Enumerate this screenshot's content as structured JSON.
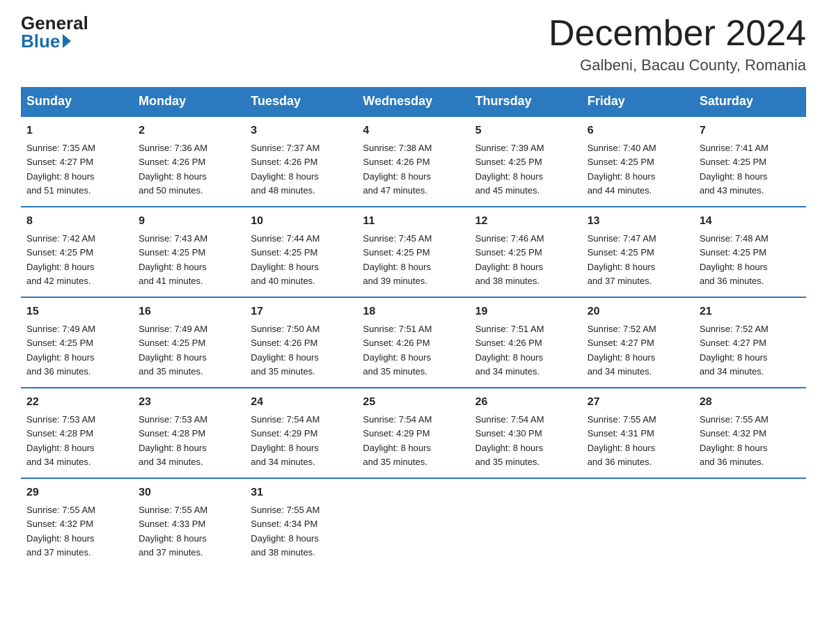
{
  "logo": {
    "general": "General",
    "blue": "Blue"
  },
  "title": "December 2024",
  "subtitle": "Galbeni, Bacau County, Romania",
  "days_of_week": [
    "Sunday",
    "Monday",
    "Tuesday",
    "Wednesday",
    "Thursday",
    "Friday",
    "Saturday"
  ],
  "weeks": [
    [
      {
        "num": "1",
        "sunrise": "7:35 AM",
        "sunset": "4:27 PM",
        "daylight": "8 hours and 51 minutes."
      },
      {
        "num": "2",
        "sunrise": "7:36 AM",
        "sunset": "4:26 PM",
        "daylight": "8 hours and 50 minutes."
      },
      {
        "num": "3",
        "sunrise": "7:37 AM",
        "sunset": "4:26 PM",
        "daylight": "8 hours and 48 minutes."
      },
      {
        "num": "4",
        "sunrise": "7:38 AM",
        "sunset": "4:26 PM",
        "daylight": "8 hours and 47 minutes."
      },
      {
        "num": "5",
        "sunrise": "7:39 AM",
        "sunset": "4:25 PM",
        "daylight": "8 hours and 45 minutes."
      },
      {
        "num": "6",
        "sunrise": "7:40 AM",
        "sunset": "4:25 PM",
        "daylight": "8 hours and 44 minutes."
      },
      {
        "num": "7",
        "sunrise": "7:41 AM",
        "sunset": "4:25 PM",
        "daylight": "8 hours and 43 minutes."
      }
    ],
    [
      {
        "num": "8",
        "sunrise": "7:42 AM",
        "sunset": "4:25 PM",
        "daylight": "8 hours and 42 minutes."
      },
      {
        "num": "9",
        "sunrise": "7:43 AM",
        "sunset": "4:25 PM",
        "daylight": "8 hours and 41 minutes."
      },
      {
        "num": "10",
        "sunrise": "7:44 AM",
        "sunset": "4:25 PM",
        "daylight": "8 hours and 40 minutes."
      },
      {
        "num": "11",
        "sunrise": "7:45 AM",
        "sunset": "4:25 PM",
        "daylight": "8 hours and 39 minutes."
      },
      {
        "num": "12",
        "sunrise": "7:46 AM",
        "sunset": "4:25 PM",
        "daylight": "8 hours and 38 minutes."
      },
      {
        "num": "13",
        "sunrise": "7:47 AM",
        "sunset": "4:25 PM",
        "daylight": "8 hours and 37 minutes."
      },
      {
        "num": "14",
        "sunrise": "7:48 AM",
        "sunset": "4:25 PM",
        "daylight": "8 hours and 36 minutes."
      }
    ],
    [
      {
        "num": "15",
        "sunrise": "7:49 AM",
        "sunset": "4:25 PM",
        "daylight": "8 hours and 36 minutes."
      },
      {
        "num": "16",
        "sunrise": "7:49 AM",
        "sunset": "4:25 PM",
        "daylight": "8 hours and 35 minutes."
      },
      {
        "num": "17",
        "sunrise": "7:50 AM",
        "sunset": "4:26 PM",
        "daylight": "8 hours and 35 minutes."
      },
      {
        "num": "18",
        "sunrise": "7:51 AM",
        "sunset": "4:26 PM",
        "daylight": "8 hours and 35 minutes."
      },
      {
        "num": "19",
        "sunrise": "7:51 AM",
        "sunset": "4:26 PM",
        "daylight": "8 hours and 34 minutes."
      },
      {
        "num": "20",
        "sunrise": "7:52 AM",
        "sunset": "4:27 PM",
        "daylight": "8 hours and 34 minutes."
      },
      {
        "num": "21",
        "sunrise": "7:52 AM",
        "sunset": "4:27 PM",
        "daylight": "8 hours and 34 minutes."
      }
    ],
    [
      {
        "num": "22",
        "sunrise": "7:53 AM",
        "sunset": "4:28 PM",
        "daylight": "8 hours and 34 minutes."
      },
      {
        "num": "23",
        "sunrise": "7:53 AM",
        "sunset": "4:28 PM",
        "daylight": "8 hours and 34 minutes."
      },
      {
        "num": "24",
        "sunrise": "7:54 AM",
        "sunset": "4:29 PM",
        "daylight": "8 hours and 34 minutes."
      },
      {
        "num": "25",
        "sunrise": "7:54 AM",
        "sunset": "4:29 PM",
        "daylight": "8 hours and 35 minutes."
      },
      {
        "num": "26",
        "sunrise": "7:54 AM",
        "sunset": "4:30 PM",
        "daylight": "8 hours and 35 minutes."
      },
      {
        "num": "27",
        "sunrise": "7:55 AM",
        "sunset": "4:31 PM",
        "daylight": "8 hours and 36 minutes."
      },
      {
        "num": "28",
        "sunrise": "7:55 AM",
        "sunset": "4:32 PM",
        "daylight": "8 hours and 36 minutes."
      }
    ],
    [
      {
        "num": "29",
        "sunrise": "7:55 AM",
        "sunset": "4:32 PM",
        "daylight": "8 hours and 37 minutes."
      },
      {
        "num": "30",
        "sunrise": "7:55 AM",
        "sunset": "4:33 PM",
        "daylight": "8 hours and 37 minutes."
      },
      {
        "num": "31",
        "sunrise": "7:55 AM",
        "sunset": "4:34 PM",
        "daylight": "8 hours and 38 minutes."
      },
      null,
      null,
      null,
      null
    ]
  ],
  "labels": {
    "sunrise": "Sunrise:",
    "sunset": "Sunset:",
    "daylight": "Daylight:"
  }
}
